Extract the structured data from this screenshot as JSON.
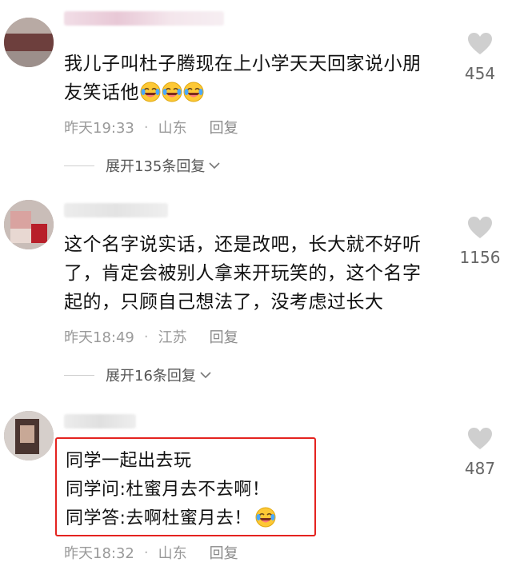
{
  "comments": [
    {
      "text_line1": "我儿子叫杜子腾现在上小学天天回家说小朋",
      "text_line2": "友笑话他",
      "time": "昨天19:33",
      "location": "山东",
      "reply": "回复",
      "expand": "展开135条回复",
      "likes": "454"
    },
    {
      "text_line1": "这个名字说实话，还是改吧，长大就不好听",
      "text_line2": "了，肯定会被别人拿来开玩笑的，这个名字",
      "text_line3": "起的，只顾自己想法了，没考虑过长大",
      "time": "昨天18:49",
      "location": "江苏",
      "reply": "回复",
      "expand": "展开16条回复",
      "likes": "1156"
    },
    {
      "text_line1": "同学一起出去玩",
      "text_line2": "同学问:杜蜜月去不去啊！",
      "text_line3": "同学答:去啊杜蜜月去！",
      "time": "昨天18:32",
      "location": "山东",
      "reply": "回复",
      "likes": "487"
    }
  ],
  "icons": {
    "like": "heart-icon",
    "laugh": "laughing-tears-emoji",
    "expand": "chevron-down-icon"
  },
  "colors": {
    "highlight_border": "#e4231f",
    "meta_text": "#9a9a9a",
    "like_icon": "#cfcfcf"
  }
}
